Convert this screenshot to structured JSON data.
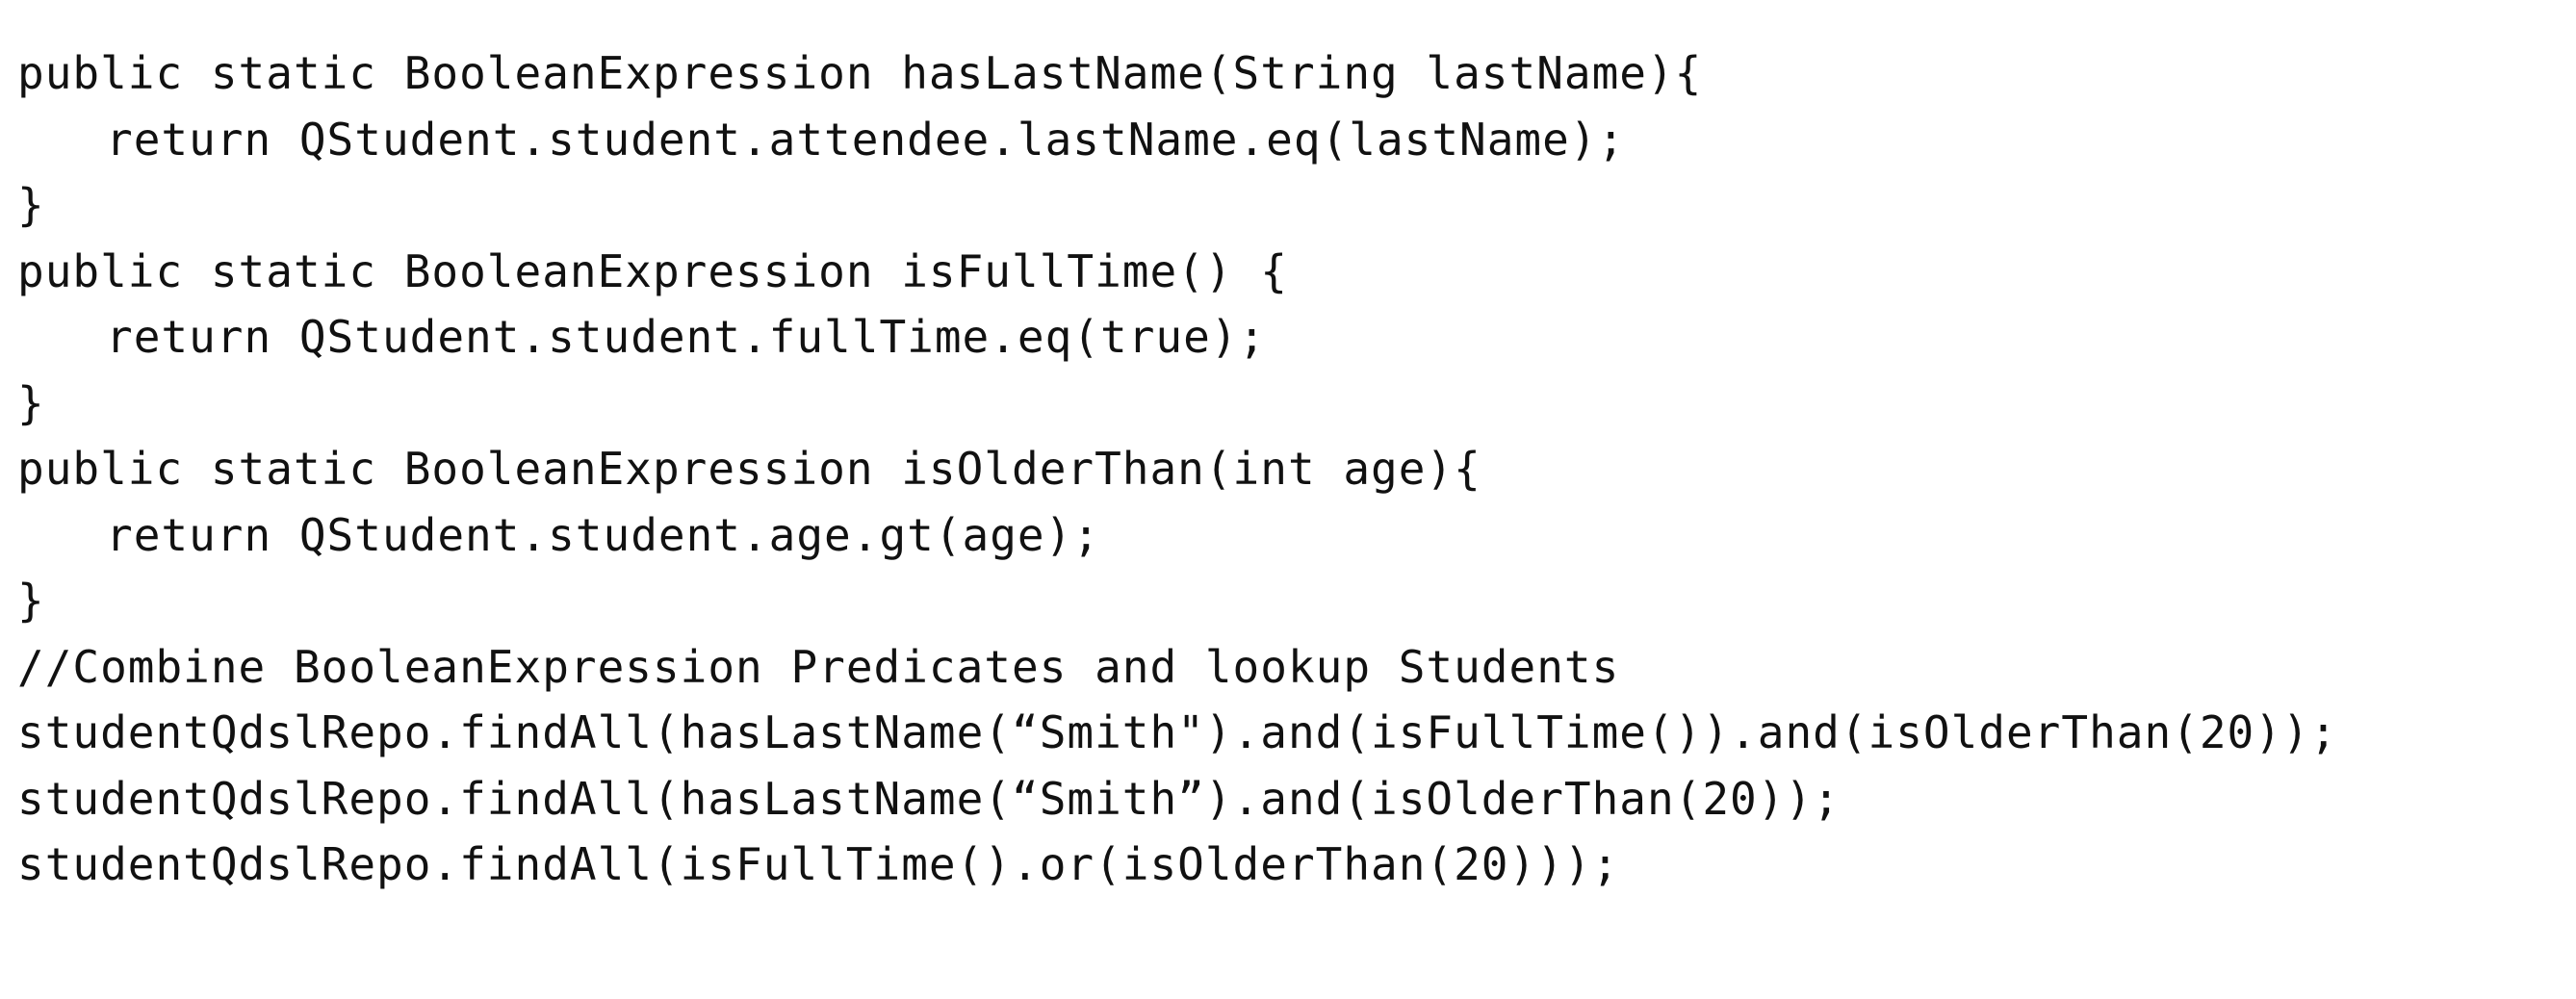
{
  "code": {
    "lines": [
      {
        "text": "public static BooleanExpression hasLastName(String lastName){",
        "indent": false
      },
      {
        "text": "return QStudent.student.attendee.lastName.eq(lastName);",
        "indent": true
      },
      {
        "text": "}",
        "indent": false
      },
      {
        "text": "public static BooleanExpression isFullTime() {",
        "indent": false
      },
      {
        "text": "return QStudent.student.fullTime.eq(true);",
        "indent": true
      },
      {
        "text": "}",
        "indent": false
      },
      {
        "text": "public static BooleanExpression isOlderThan(int age){",
        "indent": false
      },
      {
        "text": "return QStudent.student.age.gt(age);",
        "indent": true
      },
      {
        "text": "}",
        "indent": false
      },
      {
        "text": "//Combine BooleanExpression Predicates and lookup Students",
        "indent": false
      },
      {
        "text": "studentQdslRepo.findAll(hasLastName(“Smith\").and(isFullTime()).and(isOlderThan(20));",
        "indent": false
      },
      {
        "text": "studentQdslRepo.findAll(hasLastName(“Smith”).and(isOlderThan(20));",
        "indent": false
      },
      {
        "text": "studentQdslRepo.findAll(isFullTime().or(isOlderThan(20)));",
        "indent": false
      }
    ]
  }
}
